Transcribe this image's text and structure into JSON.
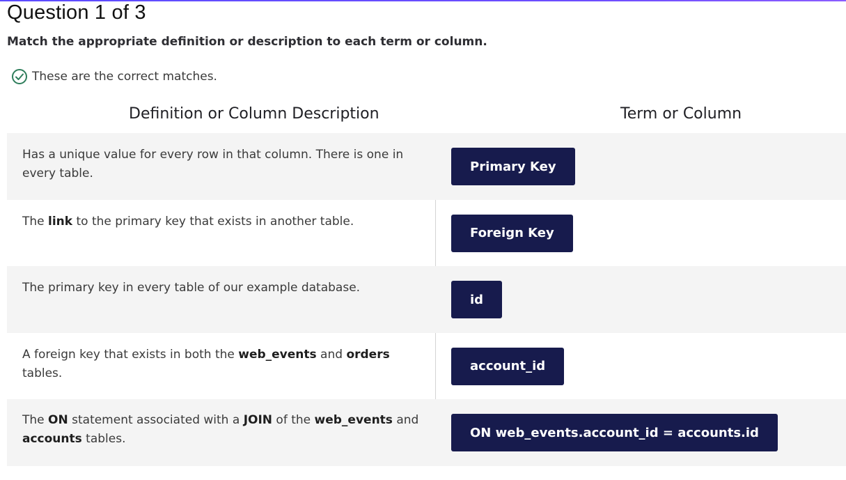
{
  "question": {
    "title": "Question 1 of 3",
    "instructions": "Match the appropriate definition or description to each term or column.",
    "status_text": "These are the correct matches."
  },
  "columns": {
    "left_header": "Definition or Column Description",
    "right_header": "Term or Column"
  },
  "rows": [
    {
      "desc_parts": [
        {
          "text": "Has a unique value for every row in that column. There is one in every table.",
          "bold": false
        }
      ],
      "term": "Primary Key"
    },
    {
      "desc_parts": [
        {
          "text": "The ",
          "bold": false
        },
        {
          "text": "link",
          "bold": true
        },
        {
          "text": " to the primary key that exists in another table.",
          "bold": false
        }
      ],
      "term": "Foreign Key"
    },
    {
      "desc_parts": [
        {
          "text": "The primary key in every table of our example database.",
          "bold": false
        }
      ],
      "term": "id"
    },
    {
      "desc_parts": [
        {
          "text": "A foreign key that exists in both the ",
          "bold": false
        },
        {
          "text": "web_events",
          "bold": true
        },
        {
          "text": " and ",
          "bold": false
        },
        {
          "text": "orders",
          "bold": true
        },
        {
          "text": " tables.",
          "bold": false
        }
      ],
      "term": "account_id"
    },
    {
      "desc_parts": [
        {
          "text": "The ",
          "bold": false
        },
        {
          "text": "ON",
          "bold": true
        },
        {
          "text": " statement associated with a ",
          "bold": false
        },
        {
          "text": "JOIN",
          "bold": true
        },
        {
          "text": " of the ",
          "bold": false
        },
        {
          "text": "web_events",
          "bold": true
        },
        {
          "text": " and ",
          "bold": false
        },
        {
          "text": "accounts",
          "bold": true
        },
        {
          "text": " tables.",
          "bold": false
        }
      ],
      "term": "ON web_events.account_id = accounts.id"
    }
  ],
  "icons": {
    "status": "check-circle-icon"
  },
  "colors": {
    "chip_bg": "#171b4d",
    "chip_text": "#ffffff",
    "success_green": "#2e7d5b",
    "row_shade": "#f4f4f4",
    "accent": "#5b4bff"
  }
}
